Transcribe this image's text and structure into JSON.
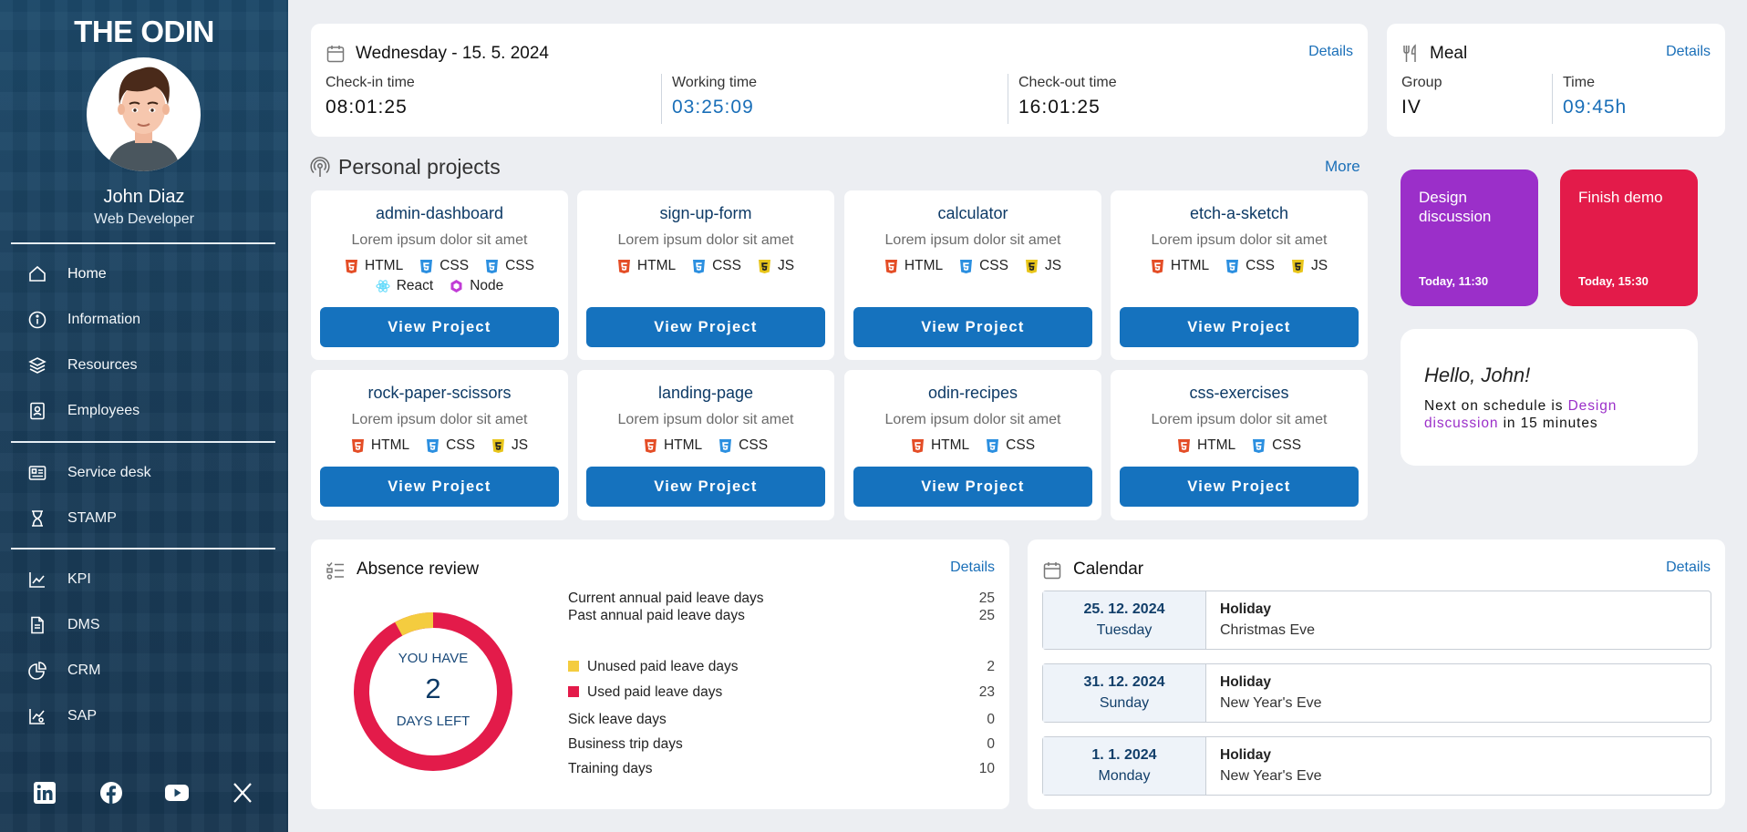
{
  "sidebar": {
    "brand": "THE ODIN",
    "user": {
      "name": "John Diaz",
      "role": "Web Developer"
    },
    "nav_group1": [
      {
        "label": "Home",
        "icon": "home-icon"
      },
      {
        "label": "Information",
        "icon": "info-icon"
      },
      {
        "label": "Resources",
        "icon": "layers-icon"
      },
      {
        "label": "Employees",
        "icon": "id-badge-icon"
      }
    ],
    "nav_group2": [
      {
        "label": "Service desk",
        "icon": "service-desk-icon"
      },
      {
        "label": "STAMP",
        "icon": "hourglass-icon"
      }
    ],
    "nav_group3": [
      {
        "label": "KPI",
        "icon": "chart-line-icon"
      },
      {
        "label": "DMS",
        "icon": "document-icon"
      },
      {
        "label": "CRM",
        "icon": "pie-chart-icon"
      },
      {
        "label": "SAP",
        "icon": "chart-user-icon"
      }
    ],
    "social": [
      "linkedin-icon",
      "facebook-icon",
      "youtube-icon",
      "x-twitter-icon"
    ]
  },
  "attendance": {
    "title": "Wednesday - 15. 5. 2024",
    "details": "Details",
    "checkin_label": "Check-in time",
    "checkin_value": "08:01:25",
    "working_label": "Working time",
    "working_value": "03:25:09",
    "checkout_label": "Check-out time",
    "checkout_value": "16:01:25"
  },
  "meal": {
    "title": "Meal",
    "details": "Details",
    "group_label": "Group",
    "group_value": "IV",
    "time_label": "Time",
    "time_value": "09:45h"
  },
  "projects": {
    "title": "Personal projects",
    "more": "More",
    "button_label": "View Project",
    "items": [
      {
        "name": "admin-dashboard",
        "desc": "Lorem ipsum dolor sit amet",
        "techs": [
          "HTML",
          "CSS",
          "CSS",
          "React",
          "Node"
        ]
      },
      {
        "name": "sign-up-form",
        "desc": "Lorem ipsum dolor sit amet",
        "techs": [
          "HTML",
          "CSS",
          "JS"
        ]
      },
      {
        "name": "calculator",
        "desc": "Lorem ipsum dolor sit amet",
        "techs": [
          "HTML",
          "CSS",
          "JS"
        ]
      },
      {
        "name": "etch-a-sketch",
        "desc": "Lorem ipsum dolor sit amet",
        "techs": [
          "HTML",
          "CSS",
          "JS"
        ]
      },
      {
        "name": "rock-paper-scissors",
        "desc": "Lorem ipsum dolor sit amet",
        "techs": [
          "HTML",
          "CSS",
          "JS"
        ]
      },
      {
        "name": "landing-page",
        "desc": "Lorem ipsum dolor sit amet",
        "techs": [
          "HTML",
          "CSS"
        ]
      },
      {
        "name": "odin-recipes",
        "desc": "Lorem ipsum dolor sit amet",
        "techs": [
          "HTML",
          "CSS"
        ]
      },
      {
        "name": "css-exercises",
        "desc": "Lorem ipsum dolor sit amet",
        "techs": [
          "HTML",
          "CSS"
        ]
      }
    ]
  },
  "tasks": [
    {
      "title": "Design discussion",
      "time": "Today, 11:30",
      "color": "#9b2fc9"
    },
    {
      "title": "Finish demo",
      "time": "Today, 15:30",
      "color": "#e31b4a"
    }
  ],
  "greeting": {
    "hello": "Hello, John!",
    "prefix": "Next on schedule is",
    "event": "Design discussion",
    "suffix": "in 15 minutes",
    "event_color": "#9b2fc9"
  },
  "absence": {
    "title": "Absence review",
    "details": "Details",
    "donut_top": "YOU HAVE",
    "donut_number": "2",
    "donut_bottom": "DAYS LEFT",
    "rows": [
      {
        "label": "Current annual paid leave days",
        "value": "25"
      },
      {
        "label": "Past annual paid leave days",
        "value": "25"
      },
      {
        "label": "Unused paid leave days",
        "value": "2"
      },
      {
        "label": "Used paid leave days",
        "value": "23"
      },
      {
        "label": "Sick leave days",
        "value": "0"
      },
      {
        "label": "Business trip days",
        "value": "0"
      },
      {
        "label": "Training days",
        "value": "10"
      }
    ],
    "colors": {
      "unused": "#f4cc3f",
      "used": "#e31b4a"
    }
  },
  "calendar": {
    "title": "Calendar",
    "details": "Details",
    "events": [
      {
        "date": "25. 12. 2024",
        "weekday": "Tuesday",
        "type": "Holiday",
        "name": "Christmas Eve"
      },
      {
        "date": "31. 12. 2024",
        "weekday": "Sunday",
        "type": "Holiday",
        "name": "New Year's Eve"
      },
      {
        "date": "1. 1. 2024",
        "weekday": "Monday",
        "type": "Holiday",
        "name": "New Year's Eve"
      }
    ]
  }
}
